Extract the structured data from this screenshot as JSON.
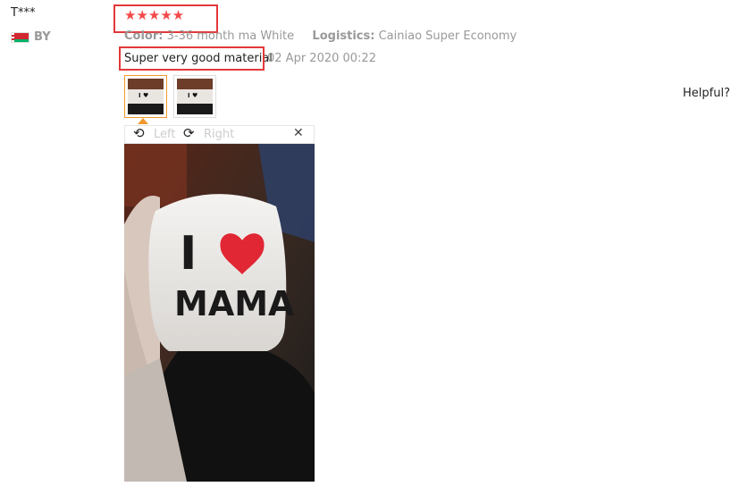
{
  "review": {
    "username": "T***",
    "country": "BY",
    "rating": 5,
    "stars": "★★★★★",
    "color_label": "Color:",
    "color_value": "3-36 month ma White",
    "logistics_label": "Logistics:",
    "logistics_value": "Cainiao Super Economy",
    "feedback": "Super very good material",
    "date": "02 Apr 2020 00:22",
    "helpful": "Helpful?",
    "thumbnails": [
      {
        "caption": "I ♥",
        "selected": true
      },
      {
        "caption": "I ♥",
        "selected": false
      }
    ]
  },
  "viewer": {
    "rotate_left_label": "Left",
    "rotate_right_label": "Right",
    "rotate_left_icon": "rotate-left-icon",
    "rotate_right_icon": "rotate-right-icon",
    "close_icon": "close-icon",
    "photo_text_line1": "I",
    "photo_text_line2": "MAMA",
    "photo_heart_text": "MAMA"
  },
  "colors": {
    "highlight": "#e3393b",
    "star": "#f44a4a",
    "accent": "#f0982e",
    "muted": "#999999"
  }
}
